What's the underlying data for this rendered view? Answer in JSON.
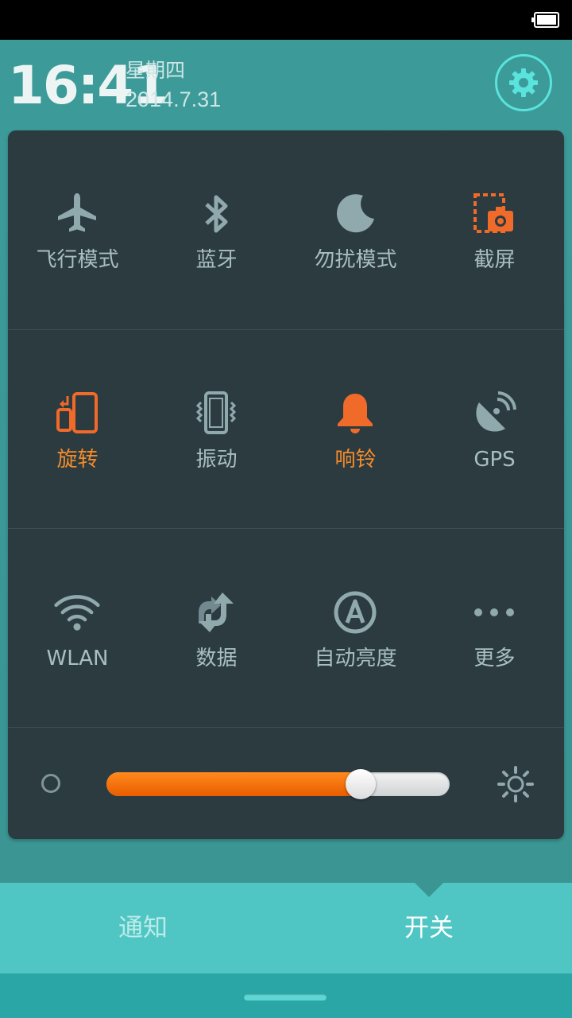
{
  "status_bar": {
    "battery_icon": "battery-full-icon"
  },
  "header": {
    "time": "16:41",
    "weekday": "星期四",
    "date": "2014.7.31",
    "settings_icon": "gear-icon"
  },
  "toggles": [
    {
      "label": "飞行模式",
      "icon": "airplane-icon",
      "active": false
    },
    {
      "label": "蓝牙",
      "icon": "bluetooth-icon",
      "active": false
    },
    {
      "label": "勿扰模式",
      "icon": "moon-icon",
      "active": false
    },
    {
      "label": "截屏",
      "icon": "screenshot-icon",
      "active": true
    },
    {
      "label": "旋转",
      "icon": "rotate-icon",
      "active": true
    },
    {
      "label": "振动",
      "icon": "vibrate-icon",
      "active": false
    },
    {
      "label": "响铃",
      "icon": "bell-icon",
      "active": true
    },
    {
      "label": "GPS",
      "icon": "gps-icon",
      "active": false
    },
    {
      "label": "WLAN",
      "icon": "wifi-icon",
      "active": false
    },
    {
      "label": "数据",
      "icon": "mobile-data-icon",
      "active": false
    },
    {
      "label": "自动亮度",
      "icon": "auto-brightness-icon",
      "active": false
    },
    {
      "label": "更多",
      "icon": "more-icon",
      "active": false
    }
  ],
  "brightness": {
    "level": 0.74,
    "low_icon": "dim-icon",
    "high_icon": "brightness-icon"
  },
  "tabs": {
    "notify": "通知",
    "switch": "开关",
    "selected": "开关"
  },
  "colors": {
    "active": "#f48c2a",
    "inactive": "#8fa9ad",
    "accent": "#59e3dc"
  }
}
